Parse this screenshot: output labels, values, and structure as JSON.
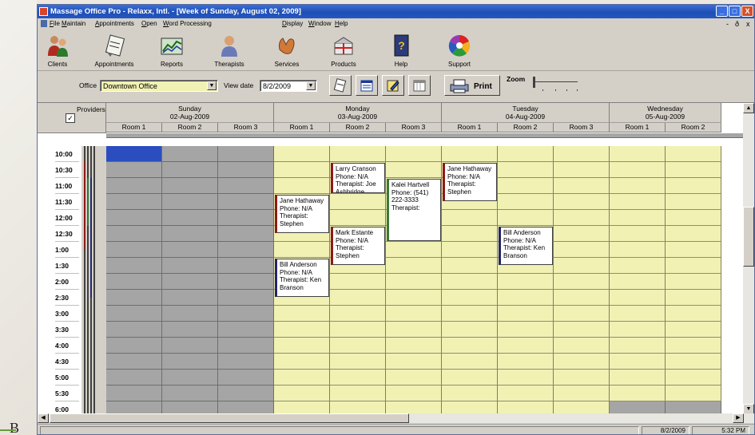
{
  "window": {
    "title": "Massage Office Pro - Relaxx, Intl. - [Week of Sunday, August 02, 2009]",
    "controls": {
      "minimize": "_",
      "maximize": "□",
      "close": "X"
    }
  },
  "menu": {
    "left": [
      "File",
      "Maintain",
      "Appointments",
      "Open",
      "Word Processing"
    ],
    "right": [
      "Display",
      "Window",
      "Help"
    ],
    "mdi": {
      "minimize": "-",
      "restore": "ð",
      "close": "x"
    }
  },
  "toolbar": [
    {
      "label": "Clients",
      "icon": "clients-icon"
    },
    {
      "label": "Appointments",
      "icon": "appointments-icon"
    },
    {
      "label": "Reports",
      "icon": "reports-icon"
    },
    {
      "label": "Therapists",
      "icon": "therapists-icon"
    },
    {
      "label": "Services",
      "icon": "services-icon"
    },
    {
      "label": "Products",
      "icon": "products-icon"
    },
    {
      "label": "Help",
      "icon": "help-book-icon"
    },
    {
      "label": "Support",
      "icon": "support-icon"
    }
  ],
  "options": {
    "office_label": "Office",
    "office_value": "Downtown Office",
    "viewdate_label": "View date",
    "viewdate_value": "8/2/2009",
    "print_label": "Print",
    "zoom_label": "Zoom",
    "zoom_level": 0
  },
  "providers_label": "Providers",
  "providers_checked": "✓",
  "days": [
    {
      "name": "Sunday",
      "date": "02-Aug-2009",
      "rooms": [
        "Room 1",
        "Room 2",
        "Room 3"
      ]
    },
    {
      "name": "Monday",
      "date": "03-Aug-2009",
      "rooms": [
        "Room 1",
        "Room 2",
        "Room 3"
      ]
    },
    {
      "name": "Tuesday",
      "date": "04-Aug-2009",
      "rooms": [
        "Room 1",
        "Room 2",
        "Room 3"
      ]
    },
    {
      "name": "Wednesday",
      "date": "05-Aug-2009",
      "rooms": [
        "Room 1",
        "Room 2"
      ]
    }
  ],
  "times": [
    "10:00",
    "10:30",
    "11:00",
    "11:30",
    "12:00",
    "12:30",
    "1:00",
    "1:30",
    "2:00",
    "2:30",
    "3:00",
    "3:30",
    "4:00",
    "4:30",
    "5:00",
    "5:30",
    "6:00"
  ],
  "appointments": [
    {
      "day": 1,
      "room": 1,
      "start": 1,
      "slots": 2,
      "color": "#8b1a1a",
      "text": "Larry Cranson\nPhone: N/A\nTherapist: Joe Ashbridge"
    },
    {
      "day": 1,
      "room": 2,
      "start": 2,
      "slots": 4,
      "color": "#3a7a3a",
      "text": "Kalei Hartvell\nPhone: (541) 222-3333\nTherapist:"
    },
    {
      "day": 1,
      "room": 0,
      "start": 3,
      "slots": 2.5,
      "color": "#8b1a1a",
      "text": "Jane Hathaway\nPhone: N/A\nTherapist: Stephen"
    },
    {
      "day": 1,
      "room": 1,
      "start": 5,
      "slots": 2.5,
      "color": "#8b1a1a",
      "text": "Mark Estante\nPhone: N/A\nTherapist: Stephen"
    },
    {
      "day": 1,
      "room": 0,
      "start": 7,
      "slots": 2.5,
      "color": "#24246e",
      "text": "Bill Anderson\nPhone: N/A\nTherapist: Ken Branson"
    },
    {
      "day": 2,
      "room": 0,
      "start": 1,
      "slots": 2.5,
      "color": "#8b1a1a",
      "text": "Jane Hathaway\nPhone: N/A\nTherapist: Stephen"
    },
    {
      "day": 2,
      "room": 1,
      "start": 5,
      "slots": 2.5,
      "color": "#24246e",
      "text": "Bill Anderson\nPhone: N/A\nTherapist: Ken Branson"
    }
  ],
  "status": {
    "date": "8/2/2009",
    "time": "5:32 PM"
  },
  "background": {
    "letter": "B"
  }
}
